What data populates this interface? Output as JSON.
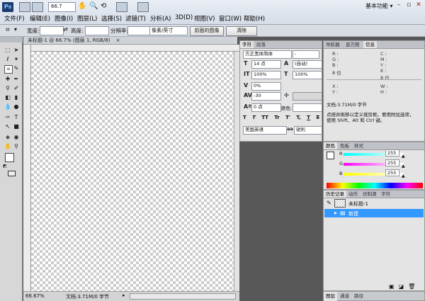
{
  "menubar": {
    "zoom": "66.7",
    "items": [
      "文件(F)",
      "编辑(E)",
      "图像(I)",
      "图层(L)",
      "选择(S)",
      "滤镜(T)",
      "分析(A)",
      "3D(D)",
      "视图(V)",
      "窗口(W)",
      "帮助(H)"
    ],
    "workspace": "基本功能",
    "workspace_arrow": "▾"
  },
  "options": {
    "width_label": "宽度:",
    "height_label": "高度:",
    "resolution_label": "分辨率:",
    "unit_value": "像素/英寸",
    "front_image_btn": "前面的图像",
    "clear_btn": "清除"
  },
  "document": {
    "tab_title": "未标题-1 @ 66.7% (图层 1, RGB/8)",
    "close": "×",
    "zoom_status": "66.67%",
    "doc_info": "文档:3.71M/0 字节"
  },
  "char_panel": {
    "tabs": [
      "字符",
      "段落"
    ],
    "font_family": "方正黑体简体",
    "font_style": "-",
    "font_size": "14 点",
    "leading": "(自动)",
    "vscale": "100%",
    "hscale": "100%",
    "baseline_shift_pct": "0%",
    "tracking": "-30",
    "baseline_shift": "0 点",
    "color_label": "颜色:",
    "style_buttons": [
      "T",
      "T",
      "TT",
      "Tr",
      "T'",
      "T,",
      "T",
      "T"
    ],
    "language": "美国英语",
    "antialias": "锐利"
  },
  "info_panel": {
    "tabs": [
      "导航器",
      "直方图",
      "信息"
    ],
    "r_label": "R :",
    "g_label": "G :",
    "b_label": "B :",
    "bit1": "8 位",
    "c_label": "C :",
    "m_label": "M :",
    "y_label": "Y :",
    "k_label": "K :",
    "bit2": "8 位",
    "x_label": "X :",
    "y2_label": "Y :",
    "w_label": "W :",
    "h_label": "H :",
    "doc_info": "文档:3.71M/0 字节",
    "hint1": "点按并拖移以定义裁剪框。要用附加选项，",
    "hint2": "使用 Shift、Alt 和 Ctrl 键。"
  },
  "color_panel": {
    "tabs": [
      "颜色",
      "色板",
      "样式"
    ],
    "r_label": "R",
    "g_label": "G",
    "b_label": "B",
    "r_value": "255",
    "g_value": "255",
    "b_value": "255",
    "levels": {
      "r": 1.0,
      "g": 1.0,
      "b": 1.0
    }
  },
  "history_panel": {
    "tabs": [
      "历史记录",
      "动作",
      "仿制源",
      "字符"
    ],
    "snapshot_label": "未标题-1",
    "step_label": "新建"
  },
  "bottom_tabs": [
    "图层",
    "通道",
    "路径"
  ],
  "colors": {
    "accent": "#3399ff",
    "workspace_bg": "#585858",
    "panel_bg": "#e4e4e4"
  }
}
